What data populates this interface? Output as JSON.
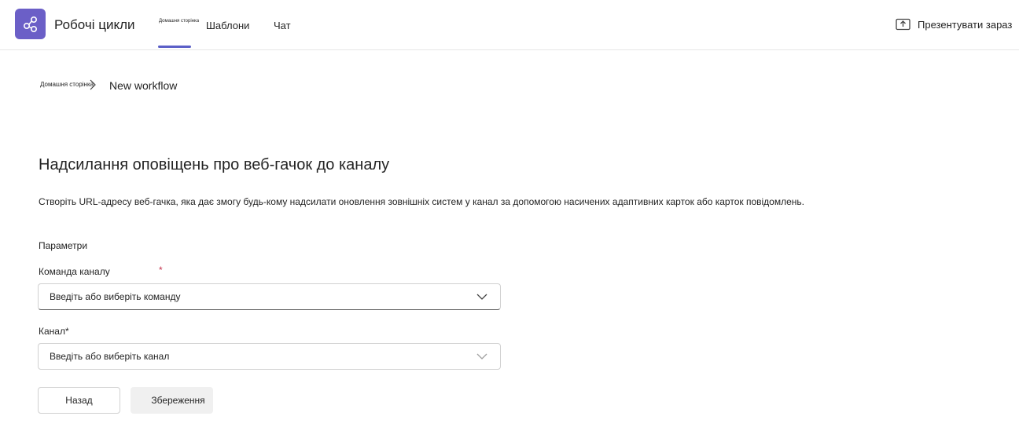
{
  "app": {
    "title": "Робочі цикли",
    "icon": "workflow-share-icon",
    "accent_color": "#6b5fc7"
  },
  "nav": {
    "tabs": [
      {
        "label": "Домашня сторінка",
        "active": true
      },
      {
        "label": "Шаблони",
        "active": false
      },
      {
        "label": "Чат",
        "active": false
      }
    ]
  },
  "header_actions": {
    "present_label": "Презентувати зараз",
    "present_overlay": "",
    "present_icon": "share-screen-icon"
  },
  "breadcrumb": {
    "home": "Домашня сторінка",
    "current": "New workflow"
  },
  "page": {
    "title": "Надсилання оповіщень про веб-гачок до каналу",
    "description": "Створіть URL-адресу веб-гачка, яка дає змогу будь-кому надсилати оновлення зовнішніх систем у канал за допомогою насичених адаптивних карток або карток повідомлень.",
    "section_label": "Параметри"
  },
  "form": {
    "team": {
      "label": "Команда каналу",
      "required_mark": "*",
      "placeholder": "Введіть або виберіть команду"
    },
    "channel": {
      "label": "Канал*",
      "placeholder": "Введіть або виберіть канал"
    }
  },
  "buttons": {
    "back": "Назад",
    "save": "Збереження"
  }
}
